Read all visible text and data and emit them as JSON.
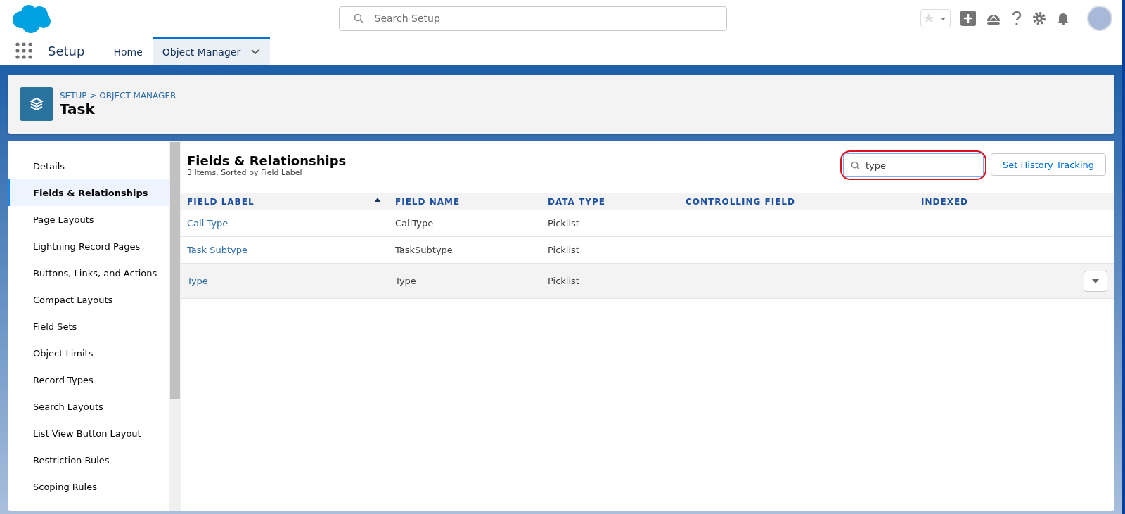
{
  "header": {
    "search": {
      "placeholder": "Search Setup"
    }
  },
  "nav": {
    "app_name": "Setup",
    "tabs": [
      {
        "label": "Home",
        "selected": false,
        "dropdown": false
      },
      {
        "label": "Object Manager",
        "selected": true,
        "dropdown": true
      }
    ]
  },
  "page_header": {
    "breadcrumb": "SETUP > OBJECT MANAGER",
    "title": "Task"
  },
  "sidebar": {
    "items": [
      {
        "label": "Details",
        "selected": false
      },
      {
        "label": "Fields & Relationships",
        "selected": true
      },
      {
        "label": "Page Layouts",
        "selected": false
      },
      {
        "label": "Lightning Record Pages",
        "selected": false
      },
      {
        "label": "Buttons, Links, and Actions",
        "selected": false
      },
      {
        "label": "Compact Layouts",
        "selected": false
      },
      {
        "label": "Field Sets",
        "selected": false
      },
      {
        "label": "Object Limits",
        "selected": false
      },
      {
        "label": "Record Types",
        "selected": false
      },
      {
        "label": "Search Layouts",
        "selected": false
      },
      {
        "label": "List View Button Layout",
        "selected": false
      },
      {
        "label": "Restriction Rules",
        "selected": false
      },
      {
        "label": "Scoping Rules",
        "selected": false
      }
    ]
  },
  "content": {
    "title": "Fields & Relationships",
    "subtitle": "3 Items, Sorted by Field Label",
    "search": {
      "value": "type",
      "annotated": true
    },
    "button": "Set History Tracking",
    "table": {
      "columns": [
        {
          "label": "FIELD LABEL",
          "sorted": true
        },
        {
          "label": "FIELD NAME",
          "sorted": false
        },
        {
          "label": "DATA TYPE",
          "sorted": false
        },
        {
          "label": "CONTROLLING FIELD",
          "sorted": false
        },
        {
          "label": "INDEXED",
          "sorted": false
        }
      ],
      "rows": [
        {
          "field_label": "Call Type",
          "field_name": "CallType",
          "data_type": "Picklist",
          "hovered": false
        },
        {
          "field_label": "Task Subtype",
          "field_name": "TaskSubtype",
          "data_type": "Picklist",
          "hovered": false
        },
        {
          "field_label": "Type",
          "field_name": "Type",
          "data_type": "Picklist",
          "hovered": true
        }
      ]
    }
  }
}
